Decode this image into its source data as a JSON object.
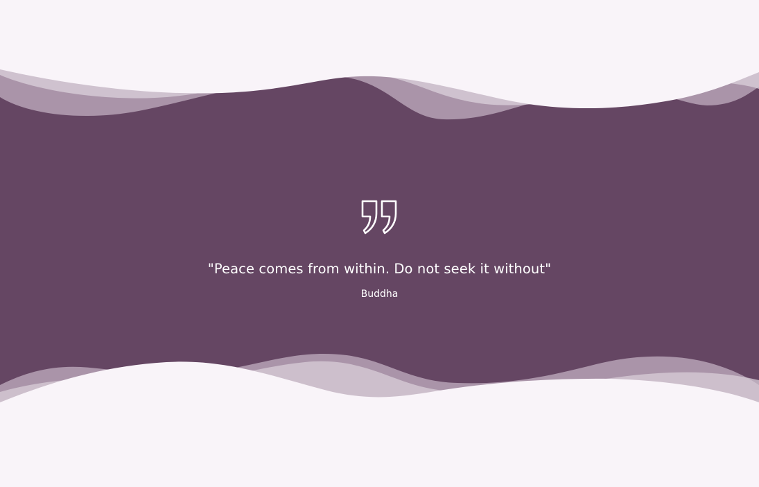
{
  "colors": {
    "band": "#654663",
    "background": "#f9f4f9",
    "wave_light": "#c0b0bf",
    "text": "#ffffff"
  },
  "quote": {
    "icon": "closing-quote-icon",
    "text": "\"Peace comes from within. Do not seek it without\"",
    "author": "Buddha"
  }
}
